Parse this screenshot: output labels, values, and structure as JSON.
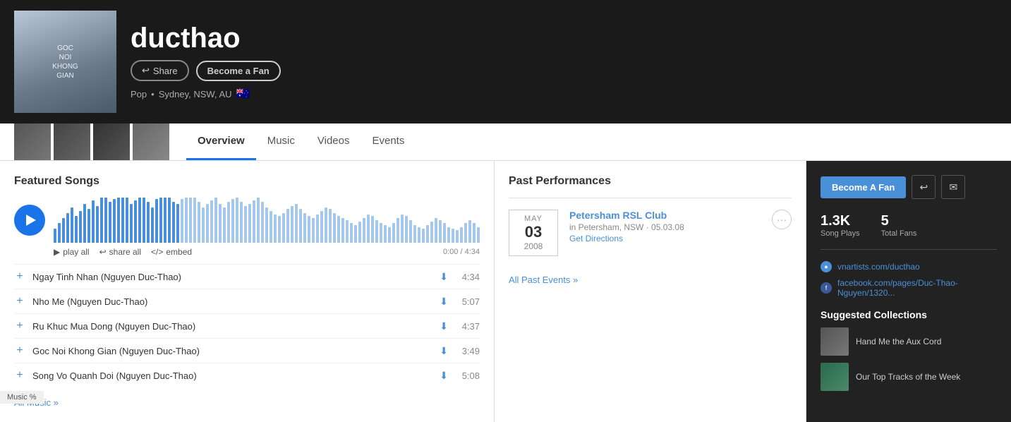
{
  "artist": {
    "name": "ducthao",
    "genre": "Pop",
    "location": "Sydney, NSW, AU",
    "flag": "🇦🇺"
  },
  "buttons": {
    "share": "Share",
    "become_fan_header": "Become a Fan",
    "become_fan_sidebar": "Become A Fan",
    "play_all": "play all",
    "share_all": "share all",
    "embed": "embed",
    "all_music": "All Music »",
    "all_past_events": "All Past Events »",
    "get_directions": "Get Directions"
  },
  "nav": {
    "tabs": [
      {
        "label": "Overview",
        "active": true
      },
      {
        "label": "Music",
        "active": false
      },
      {
        "label": "Videos",
        "active": false
      },
      {
        "label": "Events",
        "active": false
      }
    ]
  },
  "player": {
    "time_current": "0:00",
    "time_total": "4:34"
  },
  "songs": [
    {
      "title": "Ngay Tinh Nhan (Nguyen Duc-Thao)",
      "duration": "4:34"
    },
    {
      "title": "Nho Me (Nguyen Duc-Thao)",
      "duration": "5:07"
    },
    {
      "title": "Ru Khuc Mua Dong (Nguyen Duc-Thao)",
      "duration": "4:37"
    },
    {
      "title": "Goc Noi Khong Gian (Nguyen Duc-Thao)",
      "duration": "3:49"
    },
    {
      "title": "Song Vo Quanh Doi (Nguyen Duc-Thao)",
      "duration": "5:08"
    }
  ],
  "sections": {
    "featured_songs": "Featured Songs",
    "past_performances": "Past Performances",
    "suggested_collections": "Suggested Collections"
  },
  "performances": [
    {
      "month": "MAY",
      "day": "03",
      "year": "2008",
      "venue": "Petersham RSL Club",
      "location": "in Petersham, NSW · 05.03.08"
    }
  ],
  "stats": {
    "song_plays": "1.3K",
    "song_plays_label": "Song Plays",
    "total_fans": "5",
    "total_fans_label": "Total Fans"
  },
  "links": [
    {
      "icon_type": "globe",
      "url": "vnartists.com/ducthao"
    },
    {
      "icon_type": "facebook",
      "url": "facebook.com/pages/Duc-Thao-Nguyen/1320..."
    }
  ],
  "suggested": [
    {
      "label": "Hand Me the Aux Cord"
    },
    {
      "label": "Our Top Tracks of the Week"
    }
  ],
  "status_bar": {
    "music_percent": "Music %"
  },
  "cover": {
    "text_line1": "GOC",
    "text_line2": "NOI",
    "text_line3": "KHONG",
    "text_line4": "GIAN"
  }
}
